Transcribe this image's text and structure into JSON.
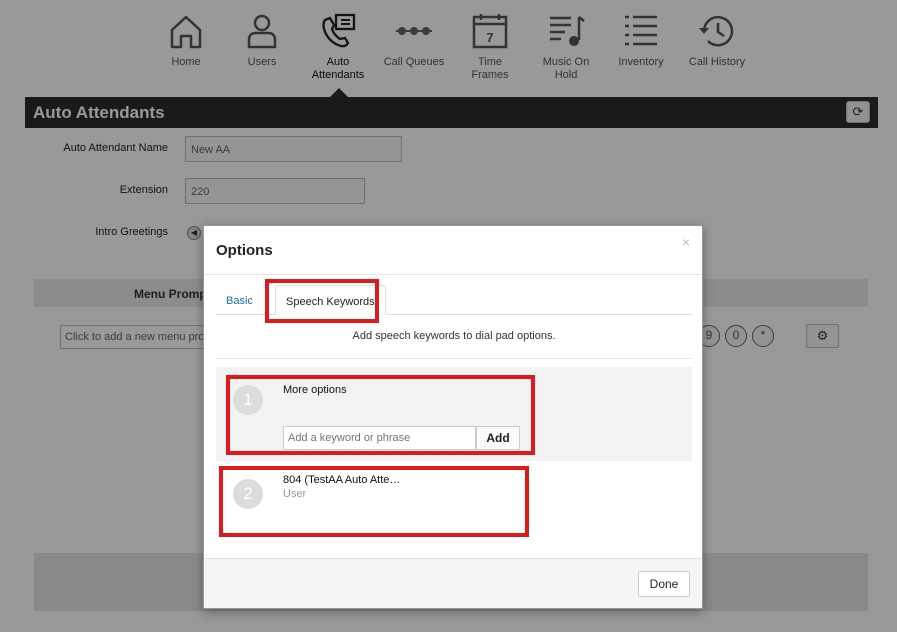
{
  "nav": {
    "items": [
      {
        "label": "Home",
        "icon": "home-icon"
      },
      {
        "label": "Users",
        "icon": "users-icon"
      },
      {
        "label": "Auto\nAttendants",
        "icon": "auto-attendant-icon"
      },
      {
        "label": "Call Queues",
        "icon": "call-queues-icon"
      },
      {
        "label": "Time\nFrames",
        "icon": "calendar-icon"
      },
      {
        "label": "Music On\nHold",
        "icon": "music-icon"
      },
      {
        "label": "Inventory",
        "icon": "list-icon"
      },
      {
        "label": "Call History",
        "icon": "history-icon"
      }
    ],
    "active": "Auto Attendants"
  },
  "page": {
    "title": "Auto Attendants",
    "name_label": "Auto Attendant Name",
    "name_value": "New AA",
    "extension_label": "Extension",
    "extension_value": "220",
    "greetings_label": "Intro Greetings",
    "menu_prompt_label": "Menu Promp",
    "menu_input_placeholder": "Click to add a new menu prom",
    "dial_keys": [
      "9",
      "0",
      "*"
    ]
  },
  "modal": {
    "title": "Options",
    "close": "×",
    "tabs": [
      {
        "label": "Basic"
      },
      {
        "label": "Speech Keywords"
      }
    ],
    "active_tab": "Speech Keywords",
    "subtitle": "Add speech keywords to dial pad options.",
    "options": [
      {
        "number": "1",
        "title": "More options",
        "subtitle": ""
      },
      {
        "number": "2",
        "title": "804 (TestAA Auto Atte…",
        "subtitle": "User"
      }
    ],
    "keyword_placeholder": "Add a keyword or phrase",
    "add_label": "Add",
    "done_label": "Done"
  },
  "colors": {
    "titlebar": "#2c2c2c",
    "highlight": "#e0191b",
    "tab_link": "#1a6fb5"
  }
}
